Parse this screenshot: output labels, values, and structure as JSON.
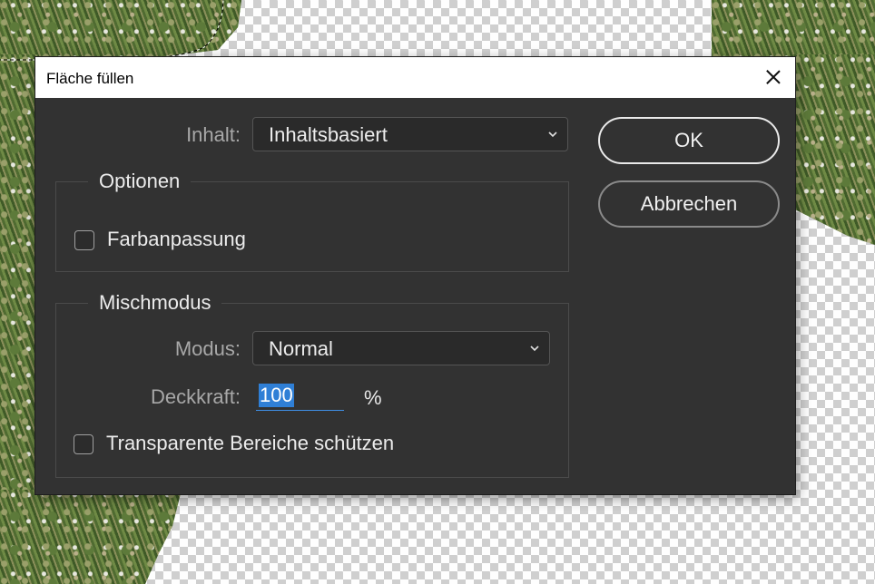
{
  "dialog": {
    "title": "Fläche füllen",
    "close_icon": "close-icon",
    "content": {
      "label": "Inhalt:",
      "value": "Inhaltsbasiert"
    },
    "options_group": {
      "legend": "Optionen",
      "color_adaptation": {
        "label": "Farbanpassung",
        "checked": false
      }
    },
    "blend_group": {
      "legend": "Mischmodus",
      "mode": {
        "label": "Modus:",
        "value": "Normal"
      },
      "opacity": {
        "label": "Deckkraft:",
        "value": "100",
        "unit": "%"
      },
      "preserve_transparency": {
        "label": "Transparente Bereiche schützen",
        "checked": false
      }
    },
    "buttons": {
      "ok": "OK",
      "cancel": "Abbrechen"
    }
  },
  "colors": {
    "dialog_bg": "#323232",
    "accent_blue": "#2f7fd6"
  }
}
